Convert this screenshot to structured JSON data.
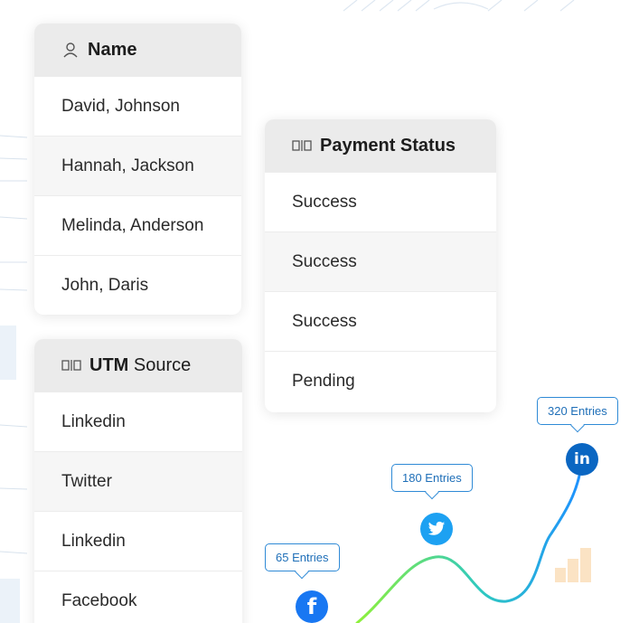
{
  "name_table": {
    "header_label": "Name",
    "rows": [
      "David, Johnson",
      "Hannah, Jackson",
      "Melinda, Anderson",
      "John, Daris"
    ]
  },
  "utm_table": {
    "header_bold": "UTM",
    "header_rest": " Source",
    "rows": [
      "Linkedin",
      "Twitter",
      "Linkedin",
      "Facebook"
    ]
  },
  "payment_table": {
    "header_label": "Payment Status",
    "rows": [
      "Success",
      "Success",
      "Success",
      "Pending"
    ]
  },
  "chart": {
    "points": [
      {
        "source": "facebook",
        "label": "65 Entries",
        "icon": "facebook-icon",
        "color": "#1877f2"
      },
      {
        "source": "twitter",
        "label": "180 Entries",
        "icon": "twitter-icon",
        "color": "#1da1f2"
      },
      {
        "source": "linkedin",
        "label": "320 Entries",
        "icon": "linkedin-icon",
        "color": "#0a66c2"
      }
    ],
    "gradient": [
      "#8ef03a",
      "#2ec9c0",
      "#1e90ff"
    ]
  },
  "chart_data": {
    "type": "line",
    "categories": [
      "Facebook",
      "Twitter",
      "Linkedin"
    ],
    "values": [
      65,
      180,
      320
    ],
    "title": "",
    "xlabel": "",
    "ylabel": ""
  }
}
